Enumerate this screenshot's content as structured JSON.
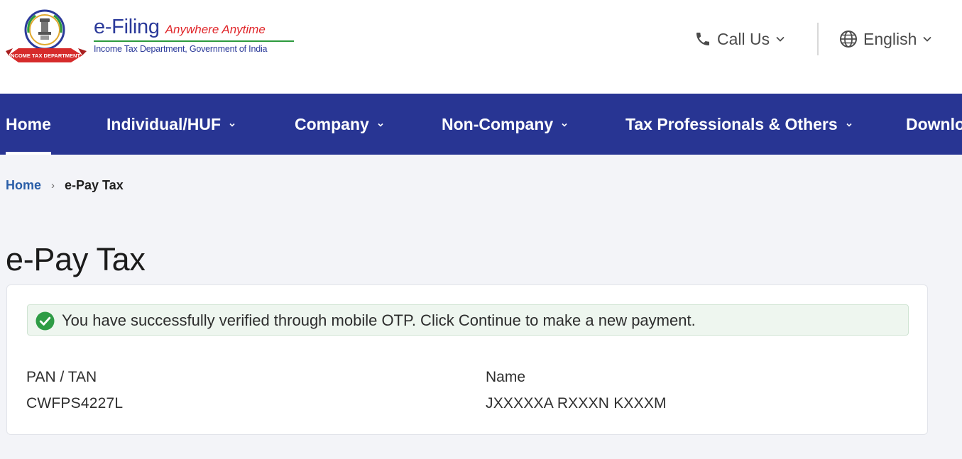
{
  "header": {
    "brand_name": "e-Filing",
    "brand_tagline": "Anywhere Anytime",
    "brand_subtitle": "Income Tax Department, Government of India",
    "emblem_ribbon_text": "INCOME TAX DEPARTMENT",
    "call_us_label": "Call Us",
    "language_label": "English",
    "colors": {
      "brand_blue": "#2b3a9a",
      "tagline_red": "#e0262a",
      "rule_green": "#2c9a3d"
    }
  },
  "nav": {
    "background": "#283593",
    "items": [
      {
        "label": "Home",
        "active": true,
        "has_dropdown": false
      },
      {
        "label": "Individual/HUF",
        "active": false,
        "has_dropdown": true
      },
      {
        "label": "Company",
        "active": false,
        "has_dropdown": true
      },
      {
        "label": "Non-Company",
        "active": false,
        "has_dropdown": true
      },
      {
        "label": "Tax Professionals & Others",
        "active": false,
        "has_dropdown": true
      },
      {
        "label": "Downlo",
        "active": false,
        "has_dropdown": false
      }
    ]
  },
  "breadcrumb": {
    "home": "Home",
    "separator": "›",
    "current": "e-Pay Tax"
  },
  "page": {
    "title": "e-Pay Tax"
  },
  "card": {
    "alert": {
      "icon": "check-circle-icon",
      "color": "#2e9c45",
      "message": "You have successfully verified through mobile OTP. Click Continue to make a new payment."
    },
    "fields": [
      {
        "label": "PAN / TAN",
        "value": "CWFPS4227L"
      },
      {
        "label": "Name",
        "value": "JXXXXXA RXXXN KXXXM"
      }
    ]
  }
}
